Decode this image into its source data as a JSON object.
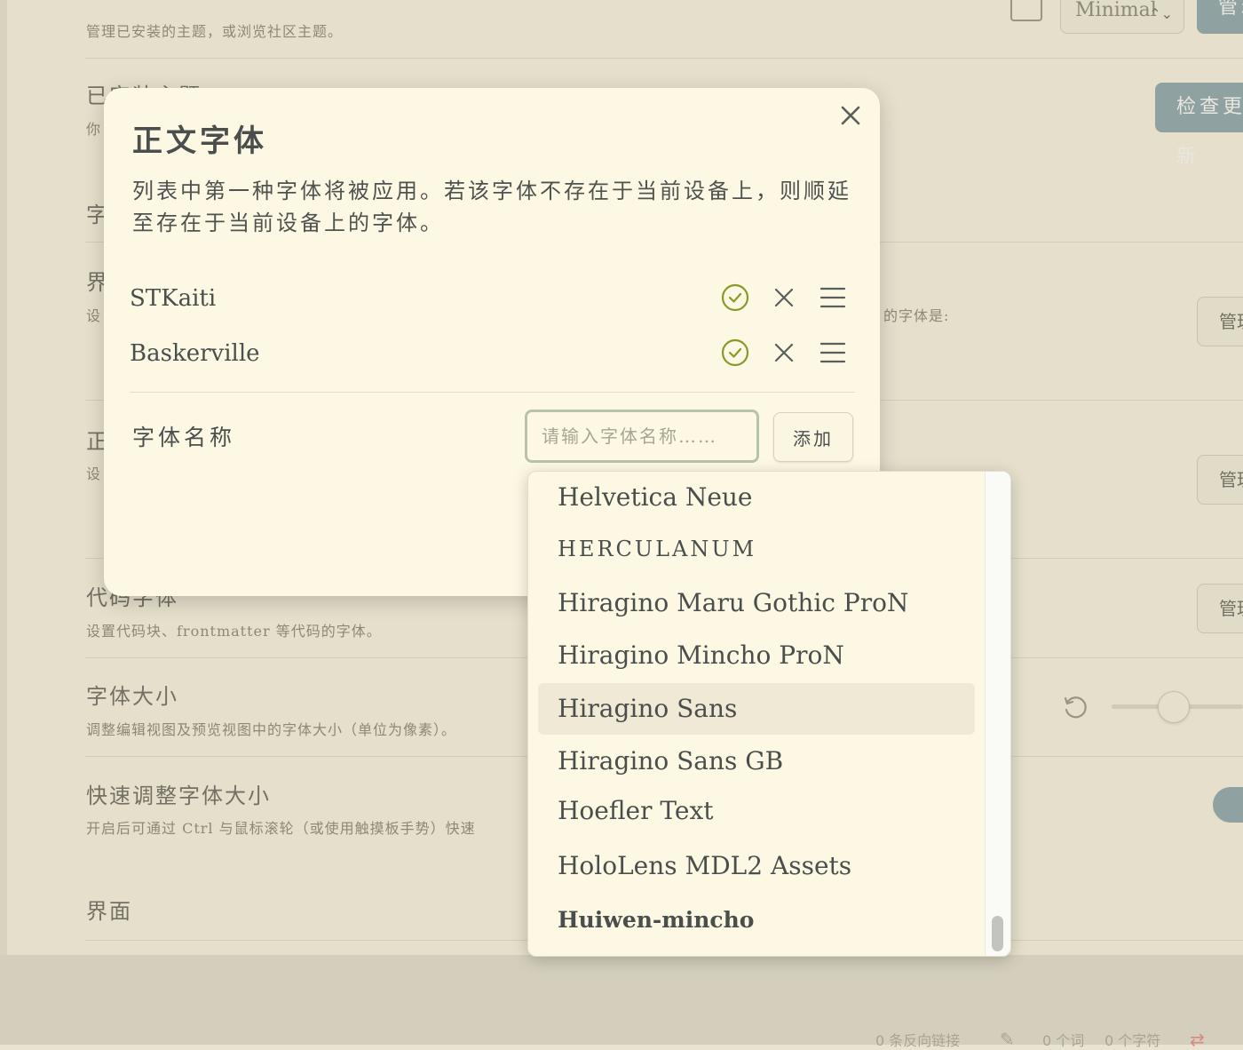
{
  "background": {
    "theme_desc": "管理已安装的主题，或浏览社区主题。",
    "theme_select": "Minimal",
    "theme_manage_btn": "管理",
    "installed_theme_title": "已安装主题",
    "installed_theme_desc": "你",
    "check_update_btn": "检查更新",
    "font_section_title": "字",
    "ui_font_title": "界",
    "ui_font_desc": "设",
    "ui_font_hint": "的字体是:",
    "manage_btn": "管理",
    "body_font_title": "正",
    "body_font_desc": "设",
    "code_font_title": "代码字体",
    "code_font_desc": "设置代码块、frontmatter 等代码的字体。",
    "font_size_title": "字体大小",
    "font_size_desc": "调整编辑视图及预览视图中的字体大小（单位为像素）。",
    "font_size_value": 0.45,
    "quick_size_title": "快速调整字体大小",
    "quick_size_desc": "开启后可通过 Ctrl 与鼠标滚轮（或使用触摸板手势）快速",
    "interface_title": "界面"
  },
  "status_bar": {
    "backlinks": "0 条反向链接",
    "words": "0 个词",
    "chars": "0 个字符"
  },
  "modal": {
    "title": "正文字体",
    "description": "列表中第一种字体将被应用。若该字体不存在于当前设备上，则顺延至存在于当前设备上的字体。",
    "fonts": [
      {
        "name": "STKaiti"
      },
      {
        "name": "Baskerville"
      }
    ],
    "field_label": "字体名称",
    "input_placeholder": "请输入字体名称……",
    "add_label": "添加"
  },
  "dropdown": {
    "items": [
      {
        "label": "Helvetica Neue"
      },
      {
        "label": "HERCULANUM"
      },
      {
        "label": "Hiragino Maru Gothic ProN"
      },
      {
        "label": "Hiragino Mincho ProN"
      },
      {
        "label": "Hiragino Sans"
      },
      {
        "label": "Hiragino Sans GB"
      },
      {
        "label": "Hoefler Text"
      },
      {
        "label": "HoloLens MDL2 Assets"
      },
      {
        "label": "Huiwen-mincho"
      }
    ],
    "selected": "Hiragino Sans"
  },
  "colors": {
    "accent_blue": "#8fa7b0",
    "check_green": "#8a9a2a",
    "background": "#fbf7e6"
  }
}
